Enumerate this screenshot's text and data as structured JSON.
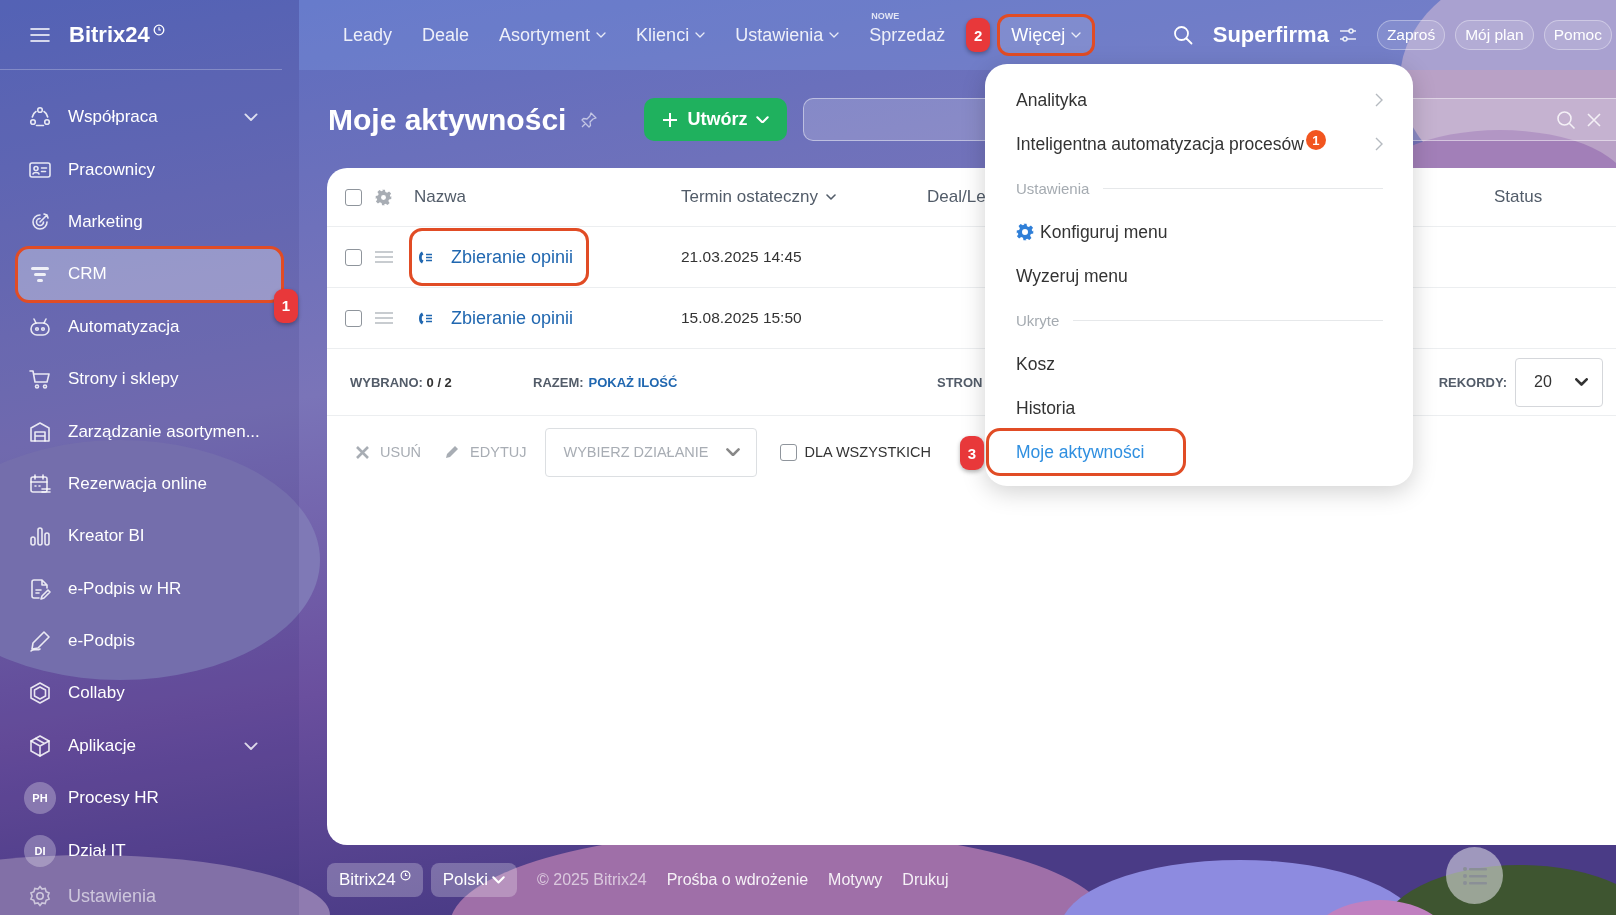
{
  "sidebar": {
    "logo": "Bitrix24",
    "items": [
      {
        "label": "Współpraca",
        "kind": "icon",
        "has_submenu": true,
        "selected": false,
        "highlighted": false
      },
      {
        "label": "Pracownicy",
        "kind": "icon",
        "has_submenu": false,
        "selected": false,
        "highlighted": false
      },
      {
        "label": "Marketing",
        "kind": "icon",
        "has_submenu": false,
        "selected": false,
        "highlighted": false
      },
      {
        "label": "CRM",
        "kind": "icon",
        "has_submenu": false,
        "selected": true,
        "highlighted": true,
        "callout": "1"
      },
      {
        "label": "Automatyzacja",
        "kind": "icon",
        "has_submenu": false,
        "selected": false,
        "highlighted": false
      },
      {
        "label": "Strony i sklepy",
        "kind": "icon",
        "has_submenu": false,
        "selected": false,
        "highlighted": false
      },
      {
        "label": "Zarządzanie asortymen...",
        "kind": "icon",
        "has_submenu": false,
        "selected": false,
        "highlighted": false
      },
      {
        "label": "Rezerwacja online",
        "kind": "icon",
        "has_submenu": false,
        "selected": false,
        "highlighted": false
      },
      {
        "label": "Kreator BI",
        "kind": "icon",
        "has_submenu": false,
        "selected": false,
        "highlighted": false
      },
      {
        "label": "e-Podpis w HR",
        "kind": "icon",
        "has_submenu": false,
        "selected": false,
        "highlighted": false
      },
      {
        "label": "e-Podpis",
        "kind": "icon",
        "has_submenu": false,
        "selected": false,
        "highlighted": false
      },
      {
        "label": "Collaby",
        "kind": "icon",
        "has_submenu": false,
        "selected": false,
        "highlighted": false
      },
      {
        "label": "Aplikacje",
        "kind": "icon",
        "has_submenu": true,
        "selected": false,
        "highlighted": false
      },
      {
        "label": "Procesy HR",
        "kind": "avatar",
        "avatar": "PH",
        "has_submenu": false,
        "selected": false,
        "highlighted": false
      },
      {
        "label": "Dział IT",
        "kind": "avatar",
        "avatar": "DI",
        "has_submenu": false,
        "selected": false,
        "highlighted": false
      }
    ],
    "settings": "Ustawienia"
  },
  "topbar": {
    "nav": [
      {
        "label": "Leady",
        "has_menu": false,
        "selected": false,
        "highlighted": false
      },
      {
        "label": "Deale",
        "has_menu": false,
        "selected": false,
        "highlighted": false
      },
      {
        "label": "Asortyment",
        "has_menu": true,
        "selected": false,
        "highlighted": false
      },
      {
        "label": "Klienci",
        "has_menu": true,
        "selected": false,
        "highlighted": false
      },
      {
        "label": "Ustawienia",
        "has_menu": true,
        "selected": false,
        "highlighted": false
      },
      {
        "label": "Sprzedaż",
        "badge": "NOWE",
        "has_menu": false,
        "selected": false,
        "highlighted": false
      },
      {
        "label": "Więcej",
        "has_menu": true,
        "selected": true,
        "highlighted": true,
        "callout": "2"
      }
    ],
    "company": "Superfirma",
    "buttons": [
      "Zaproś",
      "Mój plan",
      "Pomoc"
    ]
  },
  "page": {
    "title": "Moje aktywności",
    "create_button": "Utwórz"
  },
  "grid": {
    "all_checked": false,
    "columns": [
      {
        "label": "Nazwa",
        "sortable": false
      },
      {
        "label": "Termin ostateczny",
        "sortable": true
      },
      {
        "label": "Deal/Le",
        "sortable": false
      },
      {
        "label": "Status",
        "sortable": false
      }
    ],
    "rows": [
      {
        "name": "Zbieranie opinii",
        "deadline": "21.03.2025 14:45",
        "checked": false,
        "highlighted": true
      },
      {
        "name": "Zbieranie opinii",
        "deadline": "15.08.2025 15:50",
        "checked": false,
        "highlighted": false
      }
    ],
    "summary": {
      "selected": "WYBRANO: **0 / 2**",
      "total_label": "RAZEM:",
      "total_link": "POKAŻ ILOŚĆ",
      "pages_label": "STRON",
      "records_label": "REKORDY:",
      "records_value": "20"
    },
    "actions": [
      {
        "kind": "delete",
        "label": "USUŃ",
        "disabled": true
      },
      {
        "kind": "edit",
        "label": "EDYTUJ",
        "disabled": true
      }
    ],
    "action_select": "WYBIERZ DZIAŁANIE",
    "for_all": {
      "label": "DLA WSZYSTKICH",
      "checked": false
    }
  },
  "menu": {
    "items": [
      {
        "kind": "item",
        "label": "Analityka",
        "submenu": true,
        "selected": false,
        "highlighted": false
      },
      {
        "kind": "item",
        "label": "Inteligentna automatyzacja procesów",
        "counter": "1",
        "submenu": true,
        "selected": false,
        "highlighted": false
      },
      {
        "kind": "section",
        "label": "Ustawienia"
      },
      {
        "kind": "action",
        "label": "Konfiguruj menu",
        "submenu": false,
        "selected": false,
        "highlighted": false
      },
      {
        "kind": "item",
        "label": "Wyzeruj menu",
        "submenu": false,
        "selected": false,
        "highlighted": false
      },
      {
        "kind": "section",
        "label": "Ukryte"
      },
      {
        "kind": "item",
        "label": "Kosz",
        "submenu": false,
        "selected": false,
        "highlighted": false
      },
      {
        "kind": "item",
        "label": "Historia",
        "submenu": false,
        "selected": false,
        "highlighted": false
      },
      {
        "kind": "item",
        "label": "Moje aktywności",
        "submenu": false,
        "selected": true,
        "highlighted": true,
        "callout": "3"
      }
    ]
  },
  "footer": {
    "brand": "Bitrix24",
    "language": "Polski",
    "items": [
      {
        "kind": "text",
        "label": "© 2025 Bitrix24"
      },
      {
        "kind": "link",
        "label": "Prośba o wdrożenie"
      },
      {
        "kind": "link",
        "label": "Motywy"
      },
      {
        "kind": "link",
        "label": "Drukuj"
      }
    ]
  }
}
